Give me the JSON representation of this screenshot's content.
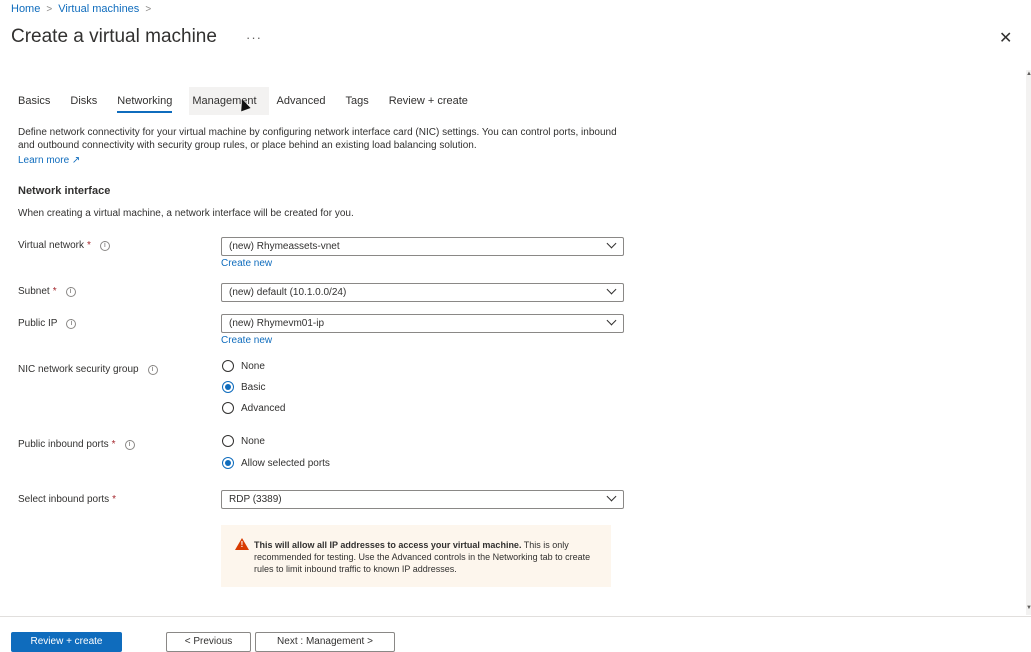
{
  "breadcrumb": {
    "home": "Home",
    "vms": "Virtual machines",
    "sep": ">"
  },
  "title": "Create a virtual machine",
  "more": "···",
  "close": "✕",
  "tabs": [
    "Basics",
    "Disks",
    "Networking",
    "Management",
    "Advanced",
    "Tags",
    "Review + create"
  ],
  "active_tab": "Networking",
  "description": "Define network connectivity for your virtual machine by configuring network interface card (NIC) settings. You can control ports, inbound and outbound connectivity with security group rules, or place behind an existing load balancing solution.",
  "learn_more": "Learn more",
  "network_interface": {
    "heading": "Network interface",
    "desc": "When creating a virtual machine, a network interface will be created for you."
  },
  "fields": {
    "vnet": {
      "label": "Virtual network",
      "value": "(new) Rhymeassets-vnet",
      "create_new": "Create new"
    },
    "subnet": {
      "label": "Subnet",
      "value": "(new) default (10.1.0.0/24)"
    },
    "public_ip": {
      "label": "Public IP",
      "value": "(new) Rhymevm01-ip",
      "create_new": "Create new"
    },
    "nsg": {
      "label": "NIC network security group",
      "options": [
        "None",
        "Basic",
        "Advanced"
      ],
      "selected": "Basic"
    },
    "inbound": {
      "label": "Public inbound ports",
      "options": [
        "None",
        "Allow selected ports"
      ],
      "selected": "Allow selected ports"
    },
    "select_ports": {
      "label": "Select inbound ports",
      "value": "RDP (3389)"
    }
  },
  "required_mark": "*",
  "info_glyph": "i",
  "warning": {
    "bold": "This will allow all IP addresses to access your virtual machine.",
    "rest": " This is only recommended for testing.  Use the Advanced controls in the Networking tab to create rules to limit inbound traffic to known IP addresses."
  },
  "buttons": {
    "review": "Review + create",
    "previous": "< Previous",
    "next": "Next : Management >"
  },
  "colors": {
    "accent": "#0f6cbd",
    "warning_bg": "#fdf6ed",
    "warning_icon": "#d83b01"
  }
}
